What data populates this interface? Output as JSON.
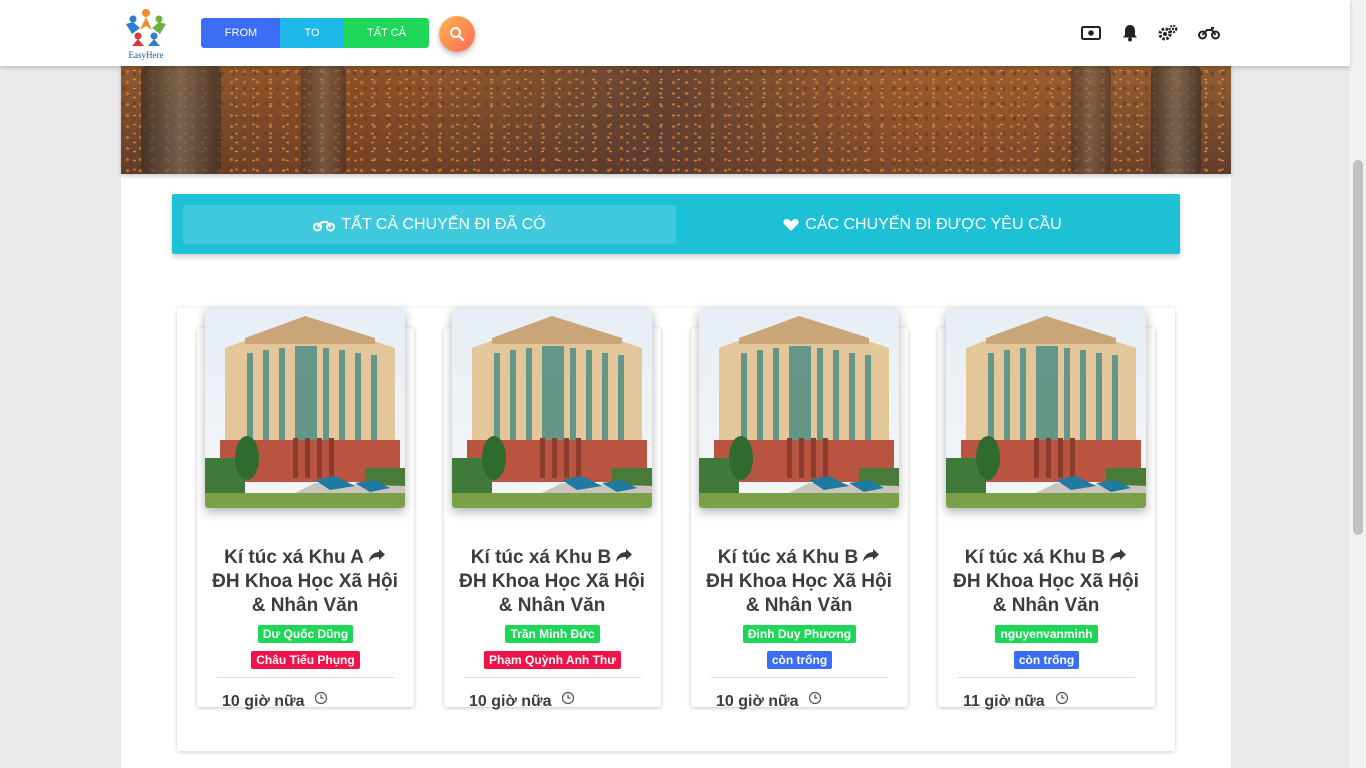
{
  "brand": {
    "name": "EasyHere"
  },
  "nav": {
    "from_label": "FROM",
    "to_label": "TO",
    "all_label": "TẤT CẢ",
    "icons": [
      "money-icon",
      "bell-icon",
      "settings-icon",
      "motorcycle-icon"
    ]
  },
  "tabs": [
    {
      "label": "TẤT CẢ CHUYẾN ĐI ĐÃ CÓ",
      "icon": "motorcycle-icon",
      "active": true
    },
    {
      "label": "CÁC CHUYẾN ĐI ĐƯỢC YÊU CẦU",
      "icon": "heart-icon",
      "active": false
    }
  ],
  "trips": [
    {
      "from": "Kí túc xá Khu A",
      "to": "ĐH Khoa Học Xã Hội & Nhân Văn",
      "driver": "Dư Quốc Dũng",
      "passenger": "Châu Tiểu Phụng",
      "passenger_status": "taken",
      "time": "10 giờ nữa"
    },
    {
      "from": "Kí túc xá Khu B",
      "to": "ĐH Khoa Học Xã Hội & Nhân Văn",
      "driver": "Trần Minh Đức",
      "passenger": "Phạm Quỳnh Anh Thư",
      "passenger_status": "taken",
      "time": "10 giờ nữa"
    },
    {
      "from": "Kí túc xá Khu B",
      "to": "ĐH Khoa Học Xã Hội & Nhân Văn",
      "driver": "Đinh Duy Phương",
      "passenger": "còn trống",
      "passenger_status": "empty",
      "time": "10 giờ nữa"
    },
    {
      "from": "Kí túc xá Khu B",
      "to": "ĐH Khoa Học Xã Hội & Nhân Văn",
      "driver": "nguyenvanminh",
      "passenger": "còn trống",
      "passenger_status": "empty",
      "time": "11 giờ nữa"
    }
  ],
  "colors": {
    "primary": "#3b6cf6",
    "info": "#1fb6e8",
    "success": "#1ed759",
    "danger": "#f2124a",
    "tab_bar": "#1ec0d6"
  }
}
